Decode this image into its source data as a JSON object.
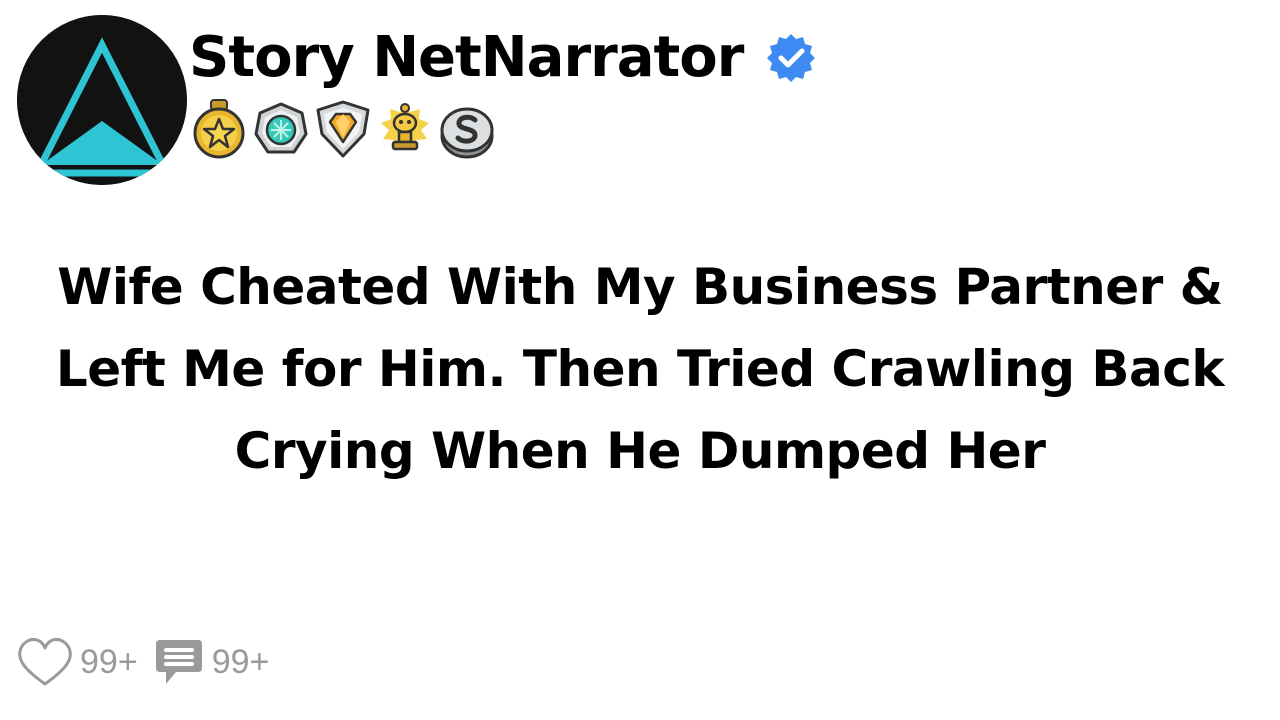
{
  "channel": {
    "name": "Story NetNarrator",
    "verified_icon": "verified-check-icon",
    "avatar_icon": "triangle-logo-icon",
    "avatar_colors": {
      "background": "#121212",
      "triangle": "#2ec4d4"
    }
  },
  "badges": [
    {
      "icon": "gold-star-badge-icon"
    },
    {
      "icon": "teal-gem-badge-icon"
    },
    {
      "icon": "diamond-crest-badge-icon"
    },
    {
      "icon": "gold-trophy-badge-icon"
    },
    {
      "icon": "silver-s-badge-icon"
    }
  ],
  "post": {
    "title": "Wife Cheated With My Business Partner & Left Me for Him. Then Tried Crawling Back Crying When He Dumped Her"
  },
  "stats": {
    "likes": "99+",
    "comments": "99+",
    "like_icon": "heart-icon",
    "comment_icon": "comment-bubble-icon"
  },
  "colors": {
    "verified": "#3d8bf2",
    "muted": "#9a9a9a"
  }
}
